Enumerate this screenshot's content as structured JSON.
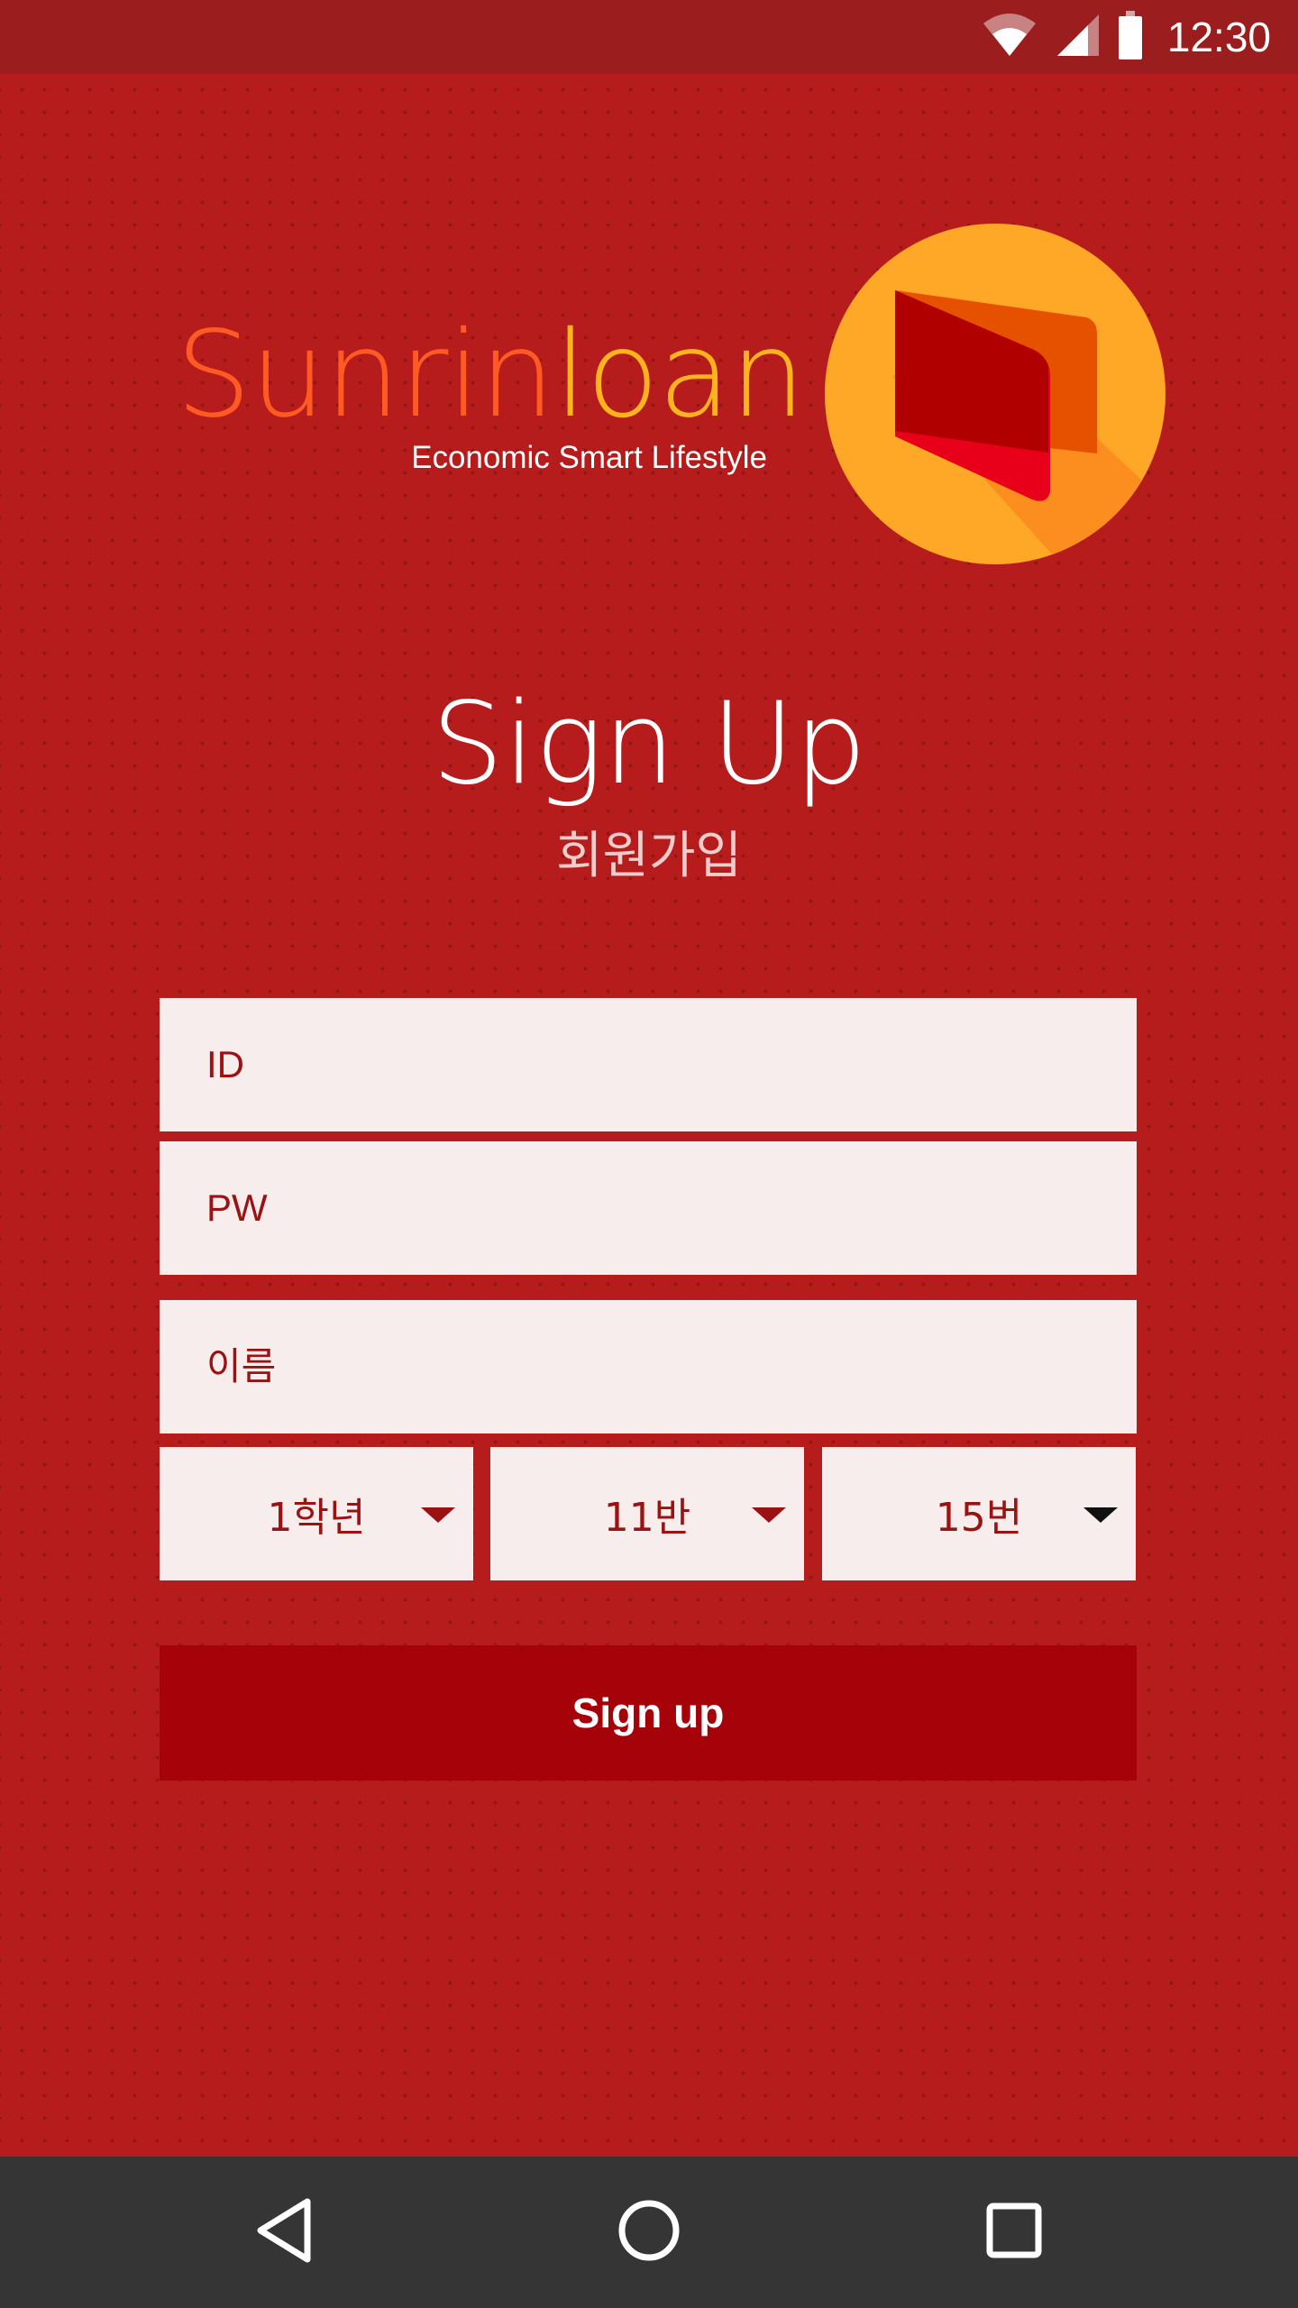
{
  "status_bar": {
    "time": "12:30",
    "icons": [
      "wifi-icon",
      "signal-icon",
      "battery-icon"
    ]
  },
  "brand": {
    "name_part1": "Sunrin",
    "name_part2": "loan",
    "tagline": "Economic Smart Lifestyle",
    "logo_icon": "wallet-icon"
  },
  "page": {
    "title": "Sign Up",
    "subtitle": "회원가입"
  },
  "form": {
    "id_placeholder": "ID",
    "pw_placeholder": "PW",
    "name_placeholder": "이름",
    "grade": "1학년",
    "class": "11반",
    "number": "15번",
    "submit_label": "Sign up"
  },
  "nav_bar": {
    "buttons": [
      "back-icon",
      "home-icon",
      "recents-icon"
    ]
  },
  "colors": {
    "background": "#b71c1c",
    "status_bar": "#9c1d1d",
    "brand_orange": "#ff5a24",
    "brand_yellow": "#ffb31f",
    "field_bg": "#f8eded",
    "field_text": "#9b1212",
    "button": "#a50309",
    "nav_bar": "#353535"
  }
}
